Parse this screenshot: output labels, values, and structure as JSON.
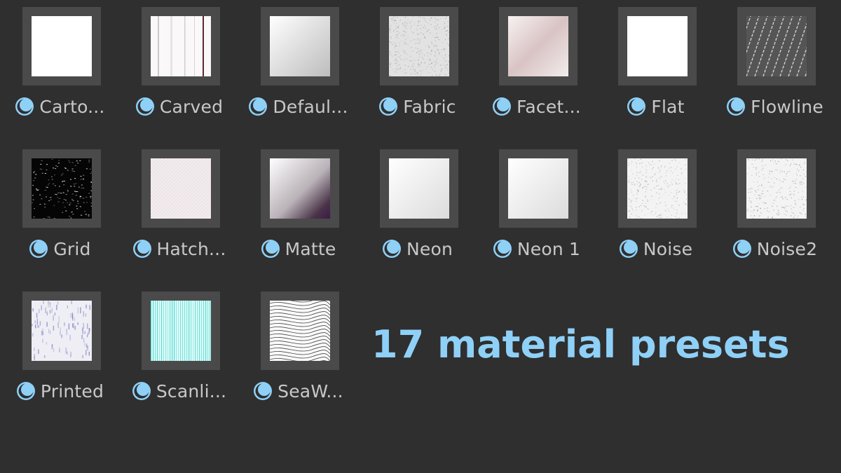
{
  "materials": [
    {
      "name": "Carto...",
      "pattern": "white"
    },
    {
      "name": "Carved",
      "pattern": "carved"
    },
    {
      "name": "Defaul...",
      "pattern": "default"
    },
    {
      "name": "Fabric",
      "pattern": "fabric"
    },
    {
      "name": "Facet...",
      "pattern": "facet"
    },
    {
      "name": "Flat",
      "pattern": "white"
    },
    {
      "name": "Flowline",
      "pattern": "flowline"
    },
    {
      "name": "Grid",
      "pattern": "grid"
    },
    {
      "name": "Hatch...",
      "pattern": "hatch"
    },
    {
      "name": "Matte",
      "pattern": "matte"
    },
    {
      "name": "Neon",
      "pattern": "neon"
    },
    {
      "name": "Neon 1",
      "pattern": "neon"
    },
    {
      "name": "Noise",
      "pattern": "noise"
    },
    {
      "name": "Noise2",
      "pattern": "noise2"
    },
    {
      "name": "Printed",
      "pattern": "printed"
    },
    {
      "name": "Scanli...",
      "pattern": "scanline"
    },
    {
      "name": "SeaW...",
      "pattern": "seawave"
    }
  ],
  "headline": "17 material presets",
  "colors": {
    "background": "#2f2f2f",
    "frame": "#4a4a4a",
    "label": "#c8c8c8",
    "icon": "#8fd0f7",
    "headline": "#8fd0f7"
  },
  "icon": "material-sphere-icon"
}
